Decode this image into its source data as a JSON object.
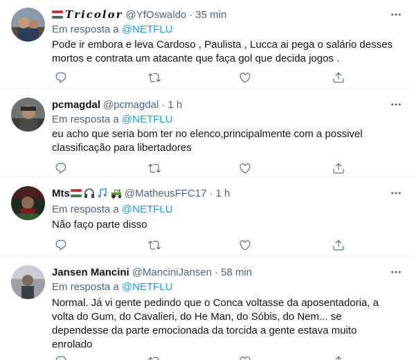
{
  "reply_prefix": "Em resposta a",
  "icons": {
    "reply": "reply-icon",
    "retweet": "retweet-icon",
    "like": "like-icon",
    "share": "share-icon",
    "more": "more-icon"
  },
  "colors": {
    "text": "#0f1419",
    "secondary": "#536471",
    "link": "#1d9bf0",
    "border": "#eff3f4"
  },
  "tweets": [
    {
      "name": "𝑻𝒓𝒊𝒄𝒐𝒍𝒐𝒓",
      "name_emoji_before": [
        "hungary-flag"
      ],
      "handle": "@YfOswaldo",
      "time": "35 min",
      "reply_to": "@NETFLU",
      "text": "Pode ir embora e leva Cardoso , Paulista , Lucca ai pega o salário desses mortos e contrata um atacante que faça gol que decida jogos ."
    },
    {
      "name": "pcmagdal",
      "handle": "@pcmagdal",
      "time": "1 h",
      "reply_to": "@NETFLU",
      "text": "eu acho que seria bom ter no elenco,principalmente com a possivel classificação para libertadores"
    },
    {
      "name": "Mts",
      "name_emoji_after": [
        "hungary-flag",
        "headphones",
        "music-notes",
        "tractor"
      ],
      "handle": "@MatheusFFC17",
      "time": "1 h",
      "reply_to": "@NETFLU",
      "text": "Não faço parte disso"
    },
    {
      "name": "Jansen Mancini",
      "handle": "@ManciniJansen",
      "time": "58 min",
      "reply_to": "@NETFLU",
      "text": "Normal. Já vi gente pedindo que o Conca voltasse da aposentadoria, a volta do Gum, do Cavalieri, do He Man, do Sóbis, do Nem...  se dependesse da parte emocionada da torcida a gente estava muito enrolado"
    }
  ]
}
